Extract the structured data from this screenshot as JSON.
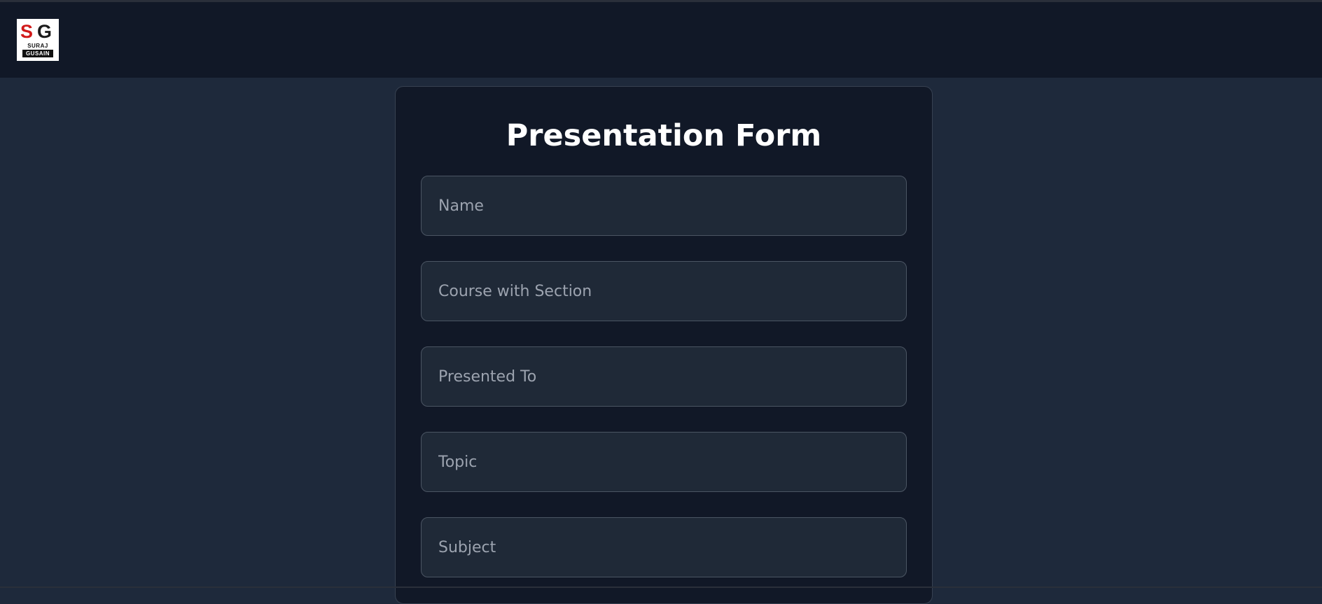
{
  "logo": {
    "letters_red": "S",
    "letters_dark": "G",
    "line1": "SURAJ",
    "line2": "GUSAIN"
  },
  "form": {
    "title": "Presentation Form",
    "fields": [
      {
        "value": "",
        "placeholder": "Name"
      },
      {
        "value": "",
        "placeholder": "Course with Section"
      },
      {
        "value": "",
        "placeholder": "Presented To"
      },
      {
        "value": "",
        "placeholder": "Topic"
      },
      {
        "value": "",
        "placeholder": "Subject"
      }
    ]
  },
  "colors": {
    "page_background": "#1e293b",
    "navbar_background": "#111827",
    "card_background": "#111827",
    "input_background": "#1f2937",
    "input_border": "#4b5563",
    "placeholder_text": "#9ca3af",
    "title_text": "#ffffff",
    "logo_accent": "#d11a1a"
  }
}
